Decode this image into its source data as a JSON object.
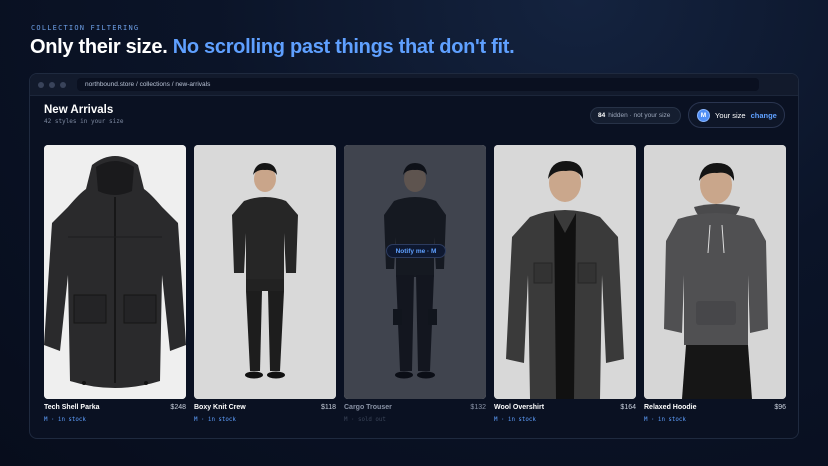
{
  "eyebrow": "COLLECTION FILTERING",
  "headline": {
    "white": "Only their size.",
    "blue": "No scrolling past things that don't fit."
  },
  "browser": {
    "url": "northbound.store / collections / new-arrivals"
  },
  "page": {
    "title": "New Arrivals",
    "subtitle": "42 styles in your size"
  },
  "hidden": {
    "count": "84",
    "label": "hidden · not your size"
  },
  "size_selector": {
    "badge": "M",
    "label": "Your size",
    "change": "change"
  },
  "products": [
    {
      "name": "Tech Shell Parka",
      "price": "$248",
      "stock": "M · in stock",
      "sold_out": false
    },
    {
      "name": "Boxy Knit Crew",
      "price": "$118",
      "stock": "M · in stock",
      "sold_out": false
    },
    {
      "name": "Cargo Trouser",
      "price": "$132",
      "stock": "M · sold out",
      "sold_out": true,
      "notify": "Notify me · M"
    },
    {
      "name": "Wool Overshirt",
      "price": "$164",
      "stock": "M · in stock",
      "sold_out": false
    },
    {
      "name": "Relaxed Hoodie",
      "price": "$96",
      "stock": "M · in stock",
      "sold_out": false
    }
  ],
  "colors": {
    "accent": "#5fa0ff",
    "background": "#0b1428"
  }
}
